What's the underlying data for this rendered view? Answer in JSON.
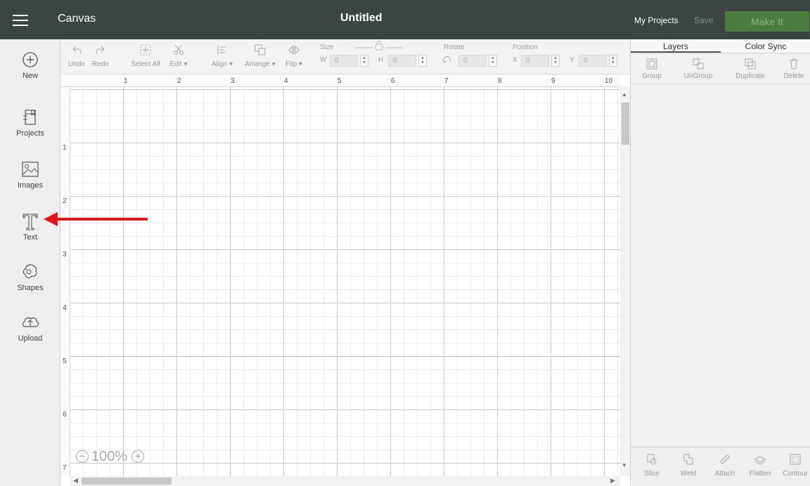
{
  "header": {
    "app_title": "Canvas",
    "doc_title": "Untitled",
    "my_projects": "My Projects",
    "save": "Save",
    "make_it": "Make It"
  },
  "sidebar": {
    "items": [
      {
        "label": "New",
        "icon": "plus-circle-icon"
      },
      {
        "label": "Projects",
        "icon": "projects-icon"
      },
      {
        "label": "Images",
        "icon": "image-icon"
      },
      {
        "label": "Text",
        "icon": "text-icon"
      },
      {
        "label": "Shapes",
        "icon": "shapes-icon"
      },
      {
        "label": "Upload",
        "icon": "cloud-upload-icon"
      }
    ]
  },
  "toolbar": {
    "undo": "Undo",
    "redo": "Redo",
    "select_all": "Select All",
    "edit": "Edit",
    "align": "Align",
    "arrange": "Arrange",
    "flip": "Flip",
    "size": "Size",
    "w": "W",
    "w_value": "0",
    "h": "H",
    "h_value": "0",
    "rotate": "Rotate",
    "rotate_value": "0",
    "position": "Position",
    "x": "X",
    "x_value": "0",
    "y": "Y",
    "y_value": "0"
  },
  "ruler": {
    "h_numbers": [
      "1",
      "2",
      "3",
      "4",
      "5",
      "6",
      "7",
      "8",
      "9",
      "10"
    ],
    "v_numbers": [
      "1",
      "2",
      "3",
      "4",
      "5",
      "6",
      "7"
    ]
  },
  "zoom": {
    "value": "100%"
  },
  "right_panel": {
    "tabs": [
      "Layers",
      "Color Sync"
    ],
    "top_actions": [
      "Group",
      "UnGroup",
      "Duplicate",
      "Delete"
    ],
    "bottom_actions": [
      "Slice",
      "Weld",
      "Attach",
      "Flatten",
      "Contour"
    ]
  },
  "colors": {
    "header_bg": "#3d4444",
    "make_it_bg": "#4d7c3f",
    "annotation_arrow": "#e8141b"
  }
}
